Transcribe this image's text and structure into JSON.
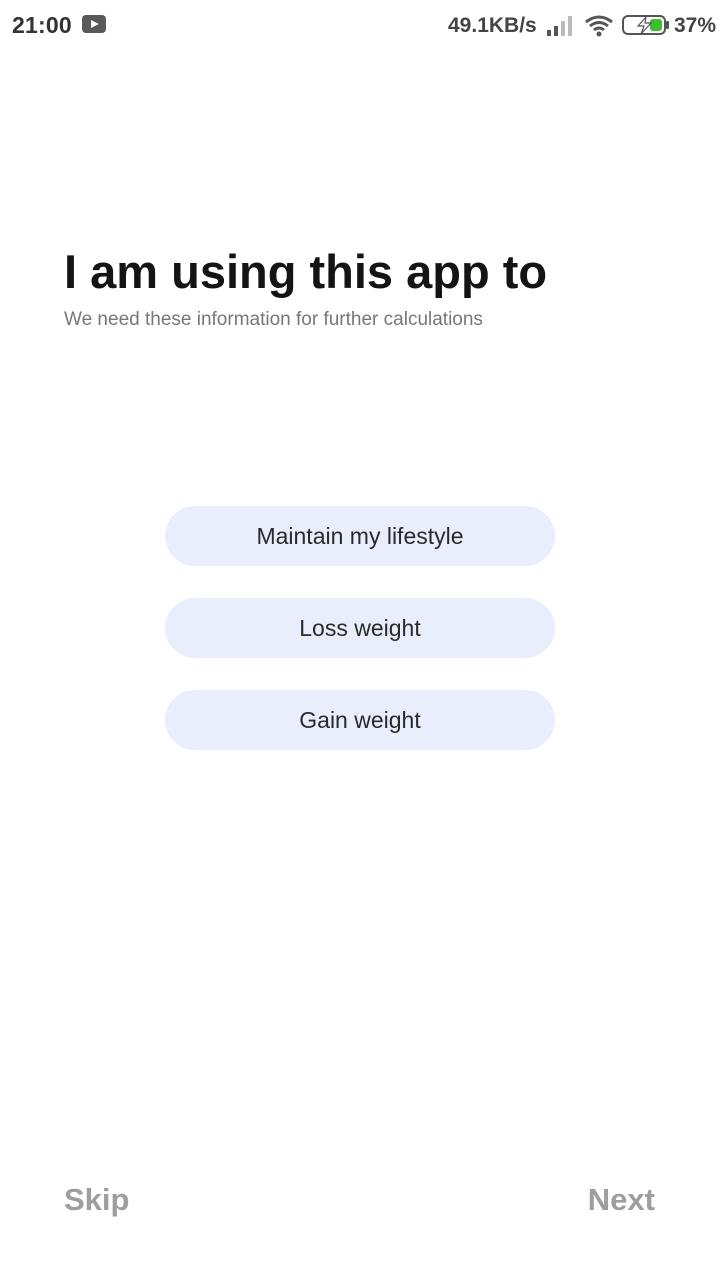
{
  "status_bar": {
    "time": "21:00",
    "net_speed": "49.1KB/s",
    "battery_percent": "37%",
    "icons": [
      "youtube-icon",
      "signal-icon",
      "wifi-icon",
      "battery-charging-icon"
    ],
    "battery_color": "#3dbd2f"
  },
  "main": {
    "title": "I am using this app to",
    "subtitle": "We need these information for further calculations",
    "options": [
      {
        "label": "Maintain my lifestyle"
      },
      {
        "label": "Loss weight"
      },
      {
        "label": "Gain weight"
      }
    ]
  },
  "footer": {
    "skip_label": "Skip",
    "next_label": "Next"
  },
  "colors": {
    "option_background": "#e8eefc",
    "footer_text": "#9e9e9e",
    "title_text": "#141414"
  }
}
